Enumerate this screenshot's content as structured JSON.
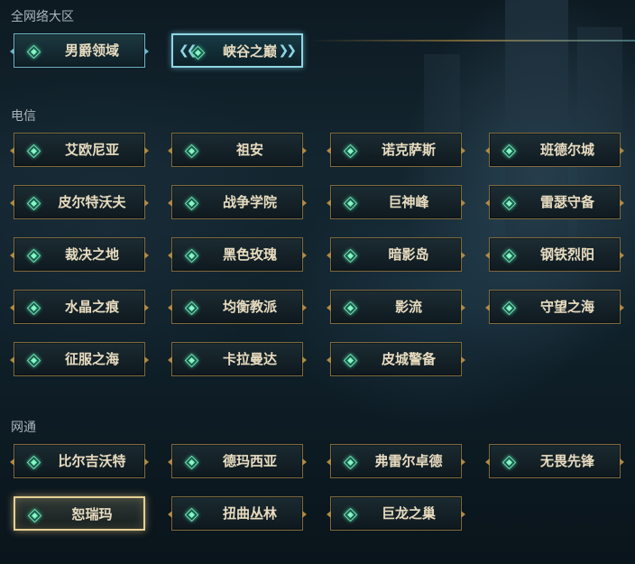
{
  "sections": {
    "all": {
      "label": "全网络大区",
      "servers": [
        "男爵领域",
        "峡谷之巅"
      ]
    },
    "telecom": {
      "label": "电信",
      "servers": [
        "艾欧尼亚",
        "祖安",
        "诺克萨斯",
        "班德尔城",
        "皮尔特沃夫",
        "战争学院",
        "巨神峰",
        "雷瑟守备",
        "裁决之地",
        "黑色玫瑰",
        "暗影岛",
        "钢铁烈阳",
        "水晶之痕",
        "均衡教派",
        "影流",
        "守望之海",
        "征服之海",
        "卡拉曼达",
        "皮城警备"
      ]
    },
    "netcom": {
      "label": "网通",
      "servers": [
        "比尔吉沃特",
        "德玛西亚",
        "弗雷尔卓德",
        "无畏先锋",
        "恕瑞玛",
        "扭曲丛林",
        "巨龙之巢"
      ]
    }
  },
  "selected_server": "恕瑞玛",
  "colors": {
    "border_gold": "#7f6a3e",
    "border_teal": "#6fb6c8",
    "text": "#e8dcc0",
    "gem": "#86f5c8",
    "selected_glow": "#e6cf94"
  },
  "icons": [
    "gem-diamond-icon"
  ]
}
